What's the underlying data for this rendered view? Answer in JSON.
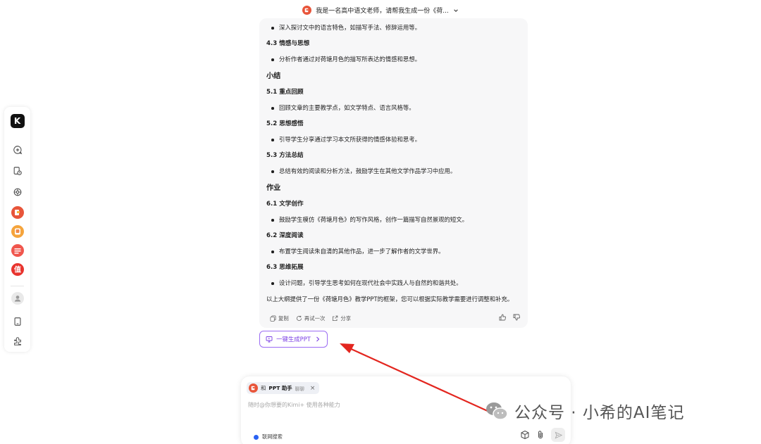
{
  "header": {
    "conversation_title": "我是一名高中语文老师，请帮我生成一份《荷..."
  },
  "sidebar": {
    "logo_letter": "K",
    "items": [
      {
        "name": "new-chat-icon"
      },
      {
        "name": "history-icon"
      },
      {
        "name": "explore-icon"
      },
      {
        "name": "ppt-helper-app-icon"
      },
      {
        "name": "app-orange-icon"
      },
      {
        "name": "app-list-icon"
      },
      {
        "name": "app-zhi-icon"
      },
      {
        "name": "user-avatar-icon"
      },
      {
        "name": "tablet-icon"
      },
      {
        "name": "plugin-icon"
      }
    ],
    "zhi_label": "值"
  },
  "message": {
    "lines": [
      {
        "kind": "bullet",
        "text": "深入探讨文中的语言特色，如描写手法、修辞运用等。"
      },
      {
        "kind": "sub",
        "text": "4.3 情感与思想"
      },
      {
        "kind": "bullet",
        "text": "分析作者通过对荷塘月色的描写所表达的情感和思想。"
      },
      {
        "kind": "sec",
        "text": "小结"
      },
      {
        "kind": "sub",
        "text": "5.1 重点回顾"
      },
      {
        "kind": "bullet",
        "text": "回顾文章的主要教学点，如文学特点、语言风格等。"
      },
      {
        "kind": "sub",
        "text": "5.2 思想感悟"
      },
      {
        "kind": "bullet",
        "text": "引导学生分享通过学习本文所获得的情感体验和思考。"
      },
      {
        "kind": "sub",
        "text": "5.3 方法总结"
      },
      {
        "kind": "bullet",
        "text": "总结有效的阅读和分析方法，鼓励学生在其他文学作品学习中应用。"
      },
      {
        "kind": "sec",
        "text": "作业"
      },
      {
        "kind": "sub",
        "text": "6.1 文学创作"
      },
      {
        "kind": "bullet",
        "text": "鼓励学生模仿《荷塘月色》的写作风格，创作一篇描写自然景观的短文。"
      },
      {
        "kind": "sub",
        "text": "6.2 深度阅读"
      },
      {
        "kind": "bullet",
        "text": "布置学生阅读朱自清的其他作品，进一步了解作者的文学世界。"
      },
      {
        "kind": "sub",
        "text": "6.3 思维拓展"
      },
      {
        "kind": "bullet",
        "text": "设计问题，引导学生思考如何在现代社会中实践人与自然的和谐共处。"
      }
    ],
    "closing": "以上大纲提供了一份《荷塘月色》教学PPT的框架，您可以根据实际教学需要进行调整和补充。",
    "actions": {
      "copy": "复制",
      "retry": "再试一次",
      "share": "分享"
    }
  },
  "generate_ppt_button": "一键生成PPT",
  "composer": {
    "chip_prefix": "和",
    "chip_name": "PPT 助手",
    "chip_suffix": "聊聊",
    "chip_close": "×",
    "placeholder": "随时@你想要的Kimi+ 使用各种能力",
    "web_search_label": "联网搜索"
  },
  "watermark": {
    "text": "公众号 · 小希的AI笔记"
  },
  "colors": {
    "accent_purple": "#7b3fe4",
    "annotation_red": "#e3261f",
    "web_search_blue": "#2a62f3"
  }
}
